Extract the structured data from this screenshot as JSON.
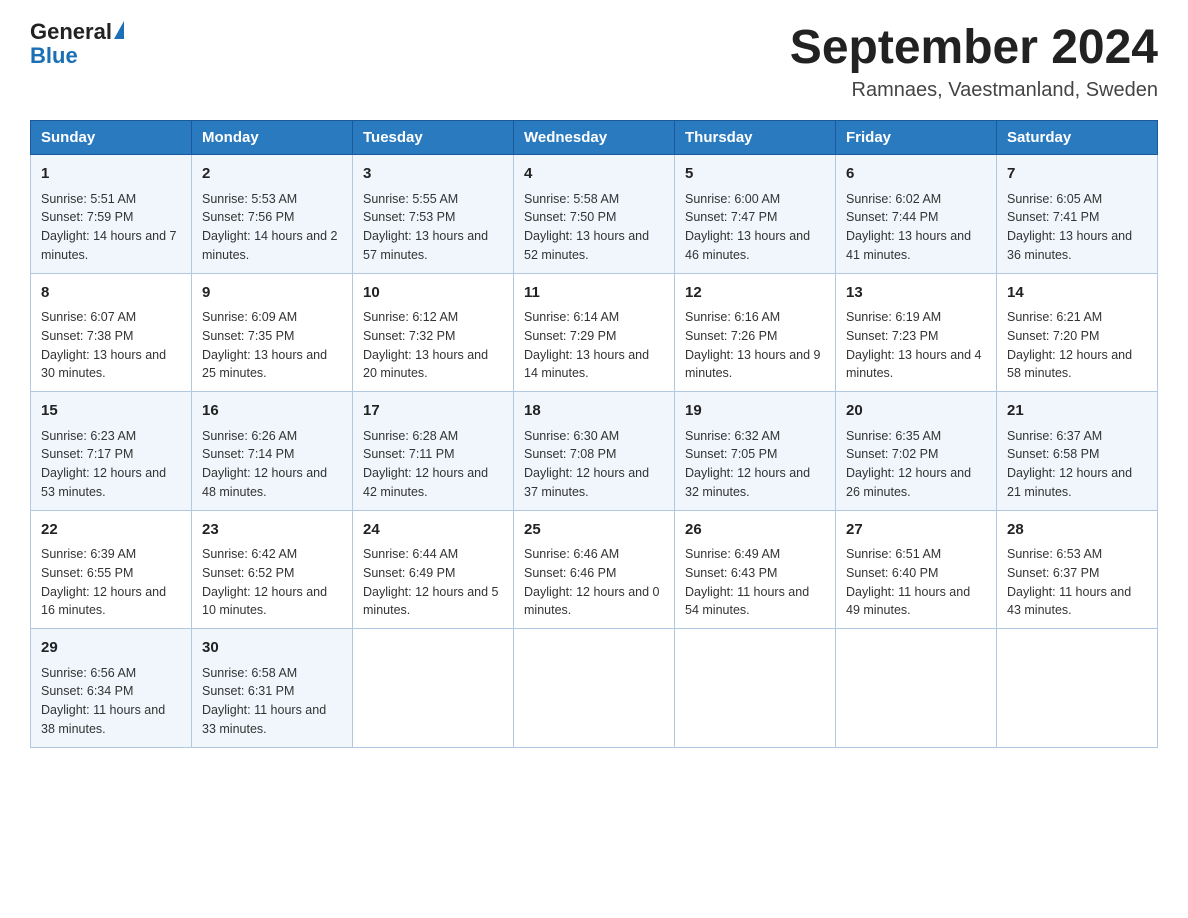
{
  "header": {
    "logo_general": "General",
    "logo_blue": "Blue",
    "month_title": "September 2024",
    "location": "Ramnaes, Vaestmanland, Sweden"
  },
  "days_of_week": [
    "Sunday",
    "Monday",
    "Tuesday",
    "Wednesday",
    "Thursday",
    "Friday",
    "Saturday"
  ],
  "weeks": [
    [
      {
        "day": "1",
        "sunrise": "5:51 AM",
        "sunset": "7:59 PM",
        "daylight": "14 hours and 7 minutes."
      },
      {
        "day": "2",
        "sunrise": "5:53 AM",
        "sunset": "7:56 PM",
        "daylight": "14 hours and 2 minutes."
      },
      {
        "day": "3",
        "sunrise": "5:55 AM",
        "sunset": "7:53 PM",
        "daylight": "13 hours and 57 minutes."
      },
      {
        "day": "4",
        "sunrise": "5:58 AM",
        "sunset": "7:50 PM",
        "daylight": "13 hours and 52 minutes."
      },
      {
        "day": "5",
        "sunrise": "6:00 AM",
        "sunset": "7:47 PM",
        "daylight": "13 hours and 46 minutes."
      },
      {
        "day": "6",
        "sunrise": "6:02 AM",
        "sunset": "7:44 PM",
        "daylight": "13 hours and 41 minutes."
      },
      {
        "day": "7",
        "sunrise": "6:05 AM",
        "sunset": "7:41 PM",
        "daylight": "13 hours and 36 minutes."
      }
    ],
    [
      {
        "day": "8",
        "sunrise": "6:07 AM",
        "sunset": "7:38 PM",
        "daylight": "13 hours and 30 minutes."
      },
      {
        "day": "9",
        "sunrise": "6:09 AM",
        "sunset": "7:35 PM",
        "daylight": "13 hours and 25 minutes."
      },
      {
        "day": "10",
        "sunrise": "6:12 AM",
        "sunset": "7:32 PM",
        "daylight": "13 hours and 20 minutes."
      },
      {
        "day": "11",
        "sunrise": "6:14 AM",
        "sunset": "7:29 PM",
        "daylight": "13 hours and 14 minutes."
      },
      {
        "day": "12",
        "sunrise": "6:16 AM",
        "sunset": "7:26 PM",
        "daylight": "13 hours and 9 minutes."
      },
      {
        "day": "13",
        "sunrise": "6:19 AM",
        "sunset": "7:23 PM",
        "daylight": "13 hours and 4 minutes."
      },
      {
        "day": "14",
        "sunrise": "6:21 AM",
        "sunset": "7:20 PM",
        "daylight": "12 hours and 58 minutes."
      }
    ],
    [
      {
        "day": "15",
        "sunrise": "6:23 AM",
        "sunset": "7:17 PM",
        "daylight": "12 hours and 53 minutes."
      },
      {
        "day": "16",
        "sunrise": "6:26 AM",
        "sunset": "7:14 PM",
        "daylight": "12 hours and 48 minutes."
      },
      {
        "day": "17",
        "sunrise": "6:28 AM",
        "sunset": "7:11 PM",
        "daylight": "12 hours and 42 minutes."
      },
      {
        "day": "18",
        "sunrise": "6:30 AM",
        "sunset": "7:08 PM",
        "daylight": "12 hours and 37 minutes."
      },
      {
        "day": "19",
        "sunrise": "6:32 AM",
        "sunset": "7:05 PM",
        "daylight": "12 hours and 32 minutes."
      },
      {
        "day": "20",
        "sunrise": "6:35 AM",
        "sunset": "7:02 PM",
        "daylight": "12 hours and 26 minutes."
      },
      {
        "day": "21",
        "sunrise": "6:37 AM",
        "sunset": "6:58 PM",
        "daylight": "12 hours and 21 minutes."
      }
    ],
    [
      {
        "day": "22",
        "sunrise": "6:39 AM",
        "sunset": "6:55 PM",
        "daylight": "12 hours and 16 minutes."
      },
      {
        "day": "23",
        "sunrise": "6:42 AM",
        "sunset": "6:52 PM",
        "daylight": "12 hours and 10 minutes."
      },
      {
        "day": "24",
        "sunrise": "6:44 AM",
        "sunset": "6:49 PM",
        "daylight": "12 hours and 5 minutes."
      },
      {
        "day": "25",
        "sunrise": "6:46 AM",
        "sunset": "6:46 PM",
        "daylight": "12 hours and 0 minutes."
      },
      {
        "day": "26",
        "sunrise": "6:49 AM",
        "sunset": "6:43 PM",
        "daylight": "11 hours and 54 minutes."
      },
      {
        "day": "27",
        "sunrise": "6:51 AM",
        "sunset": "6:40 PM",
        "daylight": "11 hours and 49 minutes."
      },
      {
        "day": "28",
        "sunrise": "6:53 AM",
        "sunset": "6:37 PM",
        "daylight": "11 hours and 43 minutes."
      }
    ],
    [
      {
        "day": "29",
        "sunrise": "6:56 AM",
        "sunset": "6:34 PM",
        "daylight": "11 hours and 38 minutes."
      },
      {
        "day": "30",
        "sunrise": "6:58 AM",
        "sunset": "6:31 PM",
        "daylight": "11 hours and 33 minutes."
      },
      null,
      null,
      null,
      null,
      null
    ]
  ]
}
